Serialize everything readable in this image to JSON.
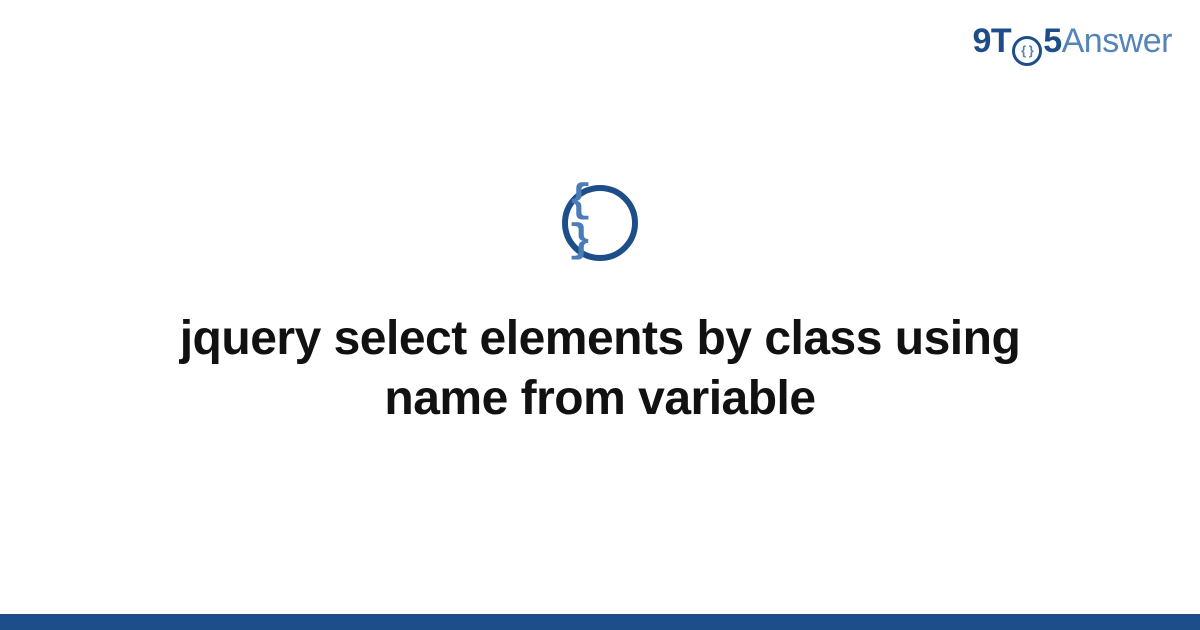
{
  "brand": {
    "part1": "9T",
    "circle_inner": "{ }",
    "part2": "5",
    "part3": "Answer"
  },
  "category": {
    "icon_name": "code-braces-icon",
    "glyph": "{ }"
  },
  "title": "jquery select elements by class using name from variable",
  "colors": {
    "primary": "#1d4e89",
    "secondary": "#5584b8",
    "text": "#111111"
  }
}
